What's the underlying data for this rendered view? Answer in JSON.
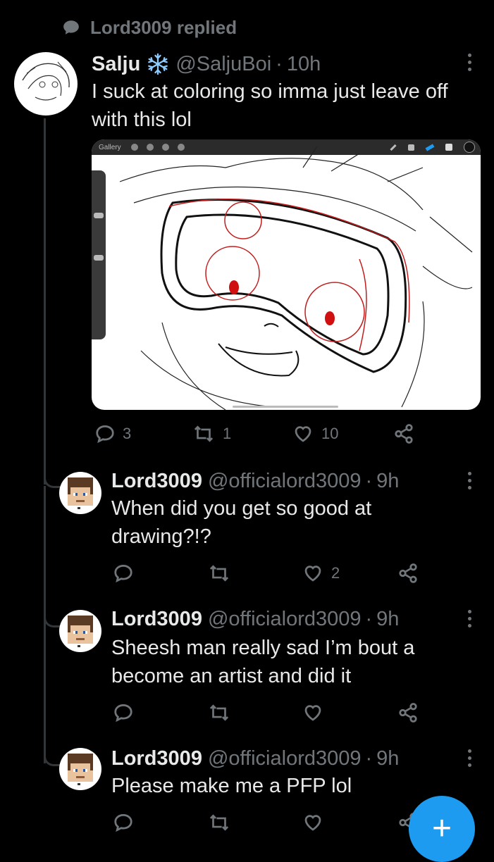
{
  "context": {
    "label": "Lord3009 replied",
    "icon": "speech-bubble-icon"
  },
  "main_tweet": {
    "name": "Salju",
    "badge_icon": "snowflake-icon",
    "handle": "@SaljuBoi",
    "separator": "·",
    "time": "10h",
    "text": "I suck at coloring so imma just leave off with this lol",
    "media": {
      "app_label": "Gallery",
      "description_icon": "sketch-drawing"
    },
    "stats": {
      "replies": "3",
      "retweets": "1",
      "likes": "10"
    }
  },
  "replies": [
    {
      "name": "Lord3009",
      "handle": "@officialord3009",
      "separator": "·",
      "time": "9h",
      "text": "When did you get so good at drawing?!?",
      "stats": {
        "replies": "",
        "retweets": "",
        "likes": "2"
      }
    },
    {
      "name": "Lord3009",
      "handle": "@officialord3009",
      "separator": "·",
      "time": "9h",
      "text": "Sheesh man really sad I’m bout a become an artist and did it",
      "stats": {
        "replies": "",
        "retweets": "",
        "likes": ""
      }
    },
    {
      "name": "Lord3009",
      "handle": "@officialord3009",
      "separator": "·",
      "time": "9h",
      "text": "Please make me a PFP lol",
      "stats": {
        "replies": "",
        "retweets": "",
        "likes": ""
      }
    }
  ],
  "fab": {
    "icon": "plus-icon",
    "label": "+"
  },
  "colors": {
    "background": "#000000",
    "text": "#e7e9ea",
    "muted": "#71767b",
    "accent": "#1d9bf0",
    "line": "#333639"
  }
}
